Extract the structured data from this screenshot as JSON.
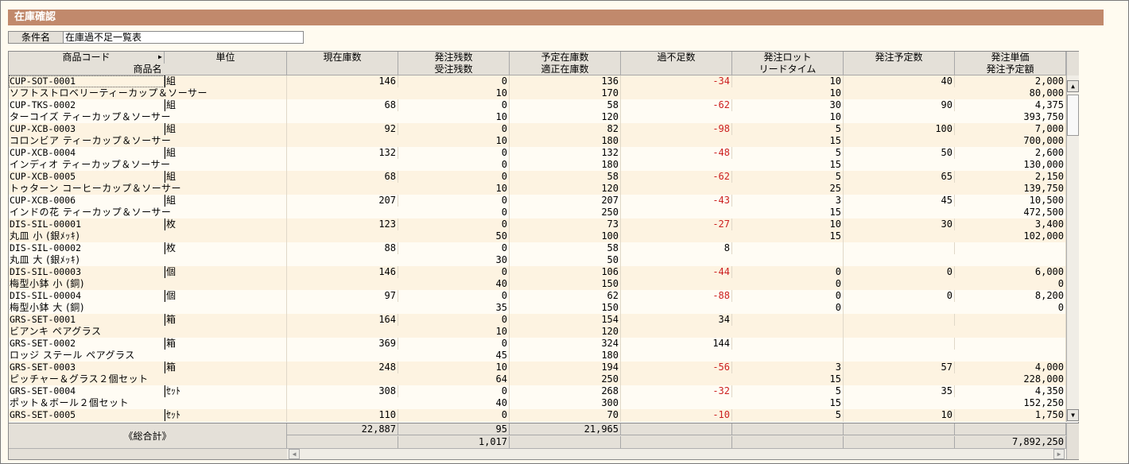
{
  "window": {
    "title": "在庫確認"
  },
  "condition": {
    "label": "条件名",
    "value": "在庫過不足一覧表"
  },
  "columns": {
    "row1": [
      "商品コード",
      "単位",
      "現在庫数",
      "発注残数",
      "予定在庫数",
      "過不足数",
      "発注ロット",
      "発注予定数",
      "発注単価"
    ],
    "row2": [
      "商品名",
      "",
      "",
      "受注残数",
      "適正在庫数",
      "",
      "リードタイム",
      "",
      "発注予定額"
    ]
  },
  "icons": {
    "sort": "sort-right-icon",
    "scroll_up": "▲",
    "scroll_down": "▼",
    "scroll_left": "◀",
    "scroll_right": "▶"
  },
  "colors": {
    "title_bg": "#c1896c",
    "negative": "#cc2020"
  },
  "rows": [
    {
      "code": "CUP-SOT-0001",
      "name": "ソフトストロベリーティーカップ＆ソーサー",
      "unit": "組",
      "stock": "146",
      "order_remain": "0",
      "recv_remain": "10",
      "planned": "136",
      "proper": "170",
      "diff": "-34",
      "neg": true,
      "lot": "10",
      "lead": "10",
      "order_qty": "40",
      "price": "2,000",
      "amount": "80,000"
    },
    {
      "code": "CUP-TKS-0002",
      "name": "ターコイズ ティーカップ＆ソーサー",
      "unit": "組",
      "stock": "68",
      "order_remain": "0",
      "recv_remain": "10",
      "planned": "58",
      "proper": "120",
      "diff": "-62",
      "neg": true,
      "lot": "30",
      "lead": "10",
      "order_qty": "90",
      "price": "4,375",
      "amount": "393,750"
    },
    {
      "code": "CUP-XCB-0003",
      "name": "コロンビア ティーカップ＆ソーサー",
      "unit": "組",
      "stock": "92",
      "order_remain": "0",
      "recv_remain": "10",
      "planned": "82",
      "proper": "180",
      "diff": "-98",
      "neg": true,
      "lot": "5",
      "lead": "15",
      "order_qty": "100",
      "price": "7,000",
      "amount": "700,000"
    },
    {
      "code": "CUP-XCB-0004",
      "name": "インディオ ティーカップ＆ソーサー",
      "unit": "組",
      "stock": "132",
      "order_remain": "0",
      "recv_remain": "0",
      "planned": "132",
      "proper": "180",
      "diff": "-48",
      "neg": true,
      "lot": "5",
      "lead": "15",
      "order_qty": "50",
      "price": "2,600",
      "amount": "130,000"
    },
    {
      "code": "CUP-XCB-0005",
      "name": "トゥターン コーヒーカップ＆ソーサー",
      "unit": "組",
      "stock": "68",
      "order_remain": "0",
      "recv_remain": "10",
      "planned": "58",
      "proper": "120",
      "diff": "-62",
      "neg": true,
      "lot": "5",
      "lead": "25",
      "order_qty": "65",
      "price": "2,150",
      "amount": "139,750"
    },
    {
      "code": "CUP-XCB-0006",
      "name": "インドの花 ティーカップ＆ソーサー",
      "unit": "組",
      "stock": "207",
      "order_remain": "0",
      "recv_remain": "0",
      "planned": "207",
      "proper": "250",
      "diff": "-43",
      "neg": true,
      "lot": "3",
      "lead": "15",
      "order_qty": "45",
      "price": "10,500",
      "amount": "472,500"
    },
    {
      "code": "DIS-SIL-00001",
      "name": "丸皿 小 (銀ﾒｯｷ)",
      "unit": "枚",
      "stock": "123",
      "order_remain": "0",
      "recv_remain": "50",
      "planned": "73",
      "proper": "100",
      "diff": "-27",
      "neg": true,
      "lot": "10",
      "lead": "15",
      "order_qty": "30",
      "price": "3,400",
      "amount": "102,000"
    },
    {
      "code": "DIS-SIL-00002",
      "name": "丸皿 大 (銀ﾒｯｷ)",
      "unit": "枚",
      "stock": "88",
      "order_remain": "0",
      "recv_remain": "30",
      "planned": "58",
      "proper": "50",
      "diff": "8",
      "neg": false,
      "lot": "",
      "lead": "",
      "order_qty": "",
      "price": "",
      "amount": ""
    },
    {
      "code": "DIS-SIL-00003",
      "name": "梅型小鉢 小 (銅)",
      "unit": "個",
      "stock": "146",
      "order_remain": "0",
      "recv_remain": "40",
      "planned": "106",
      "proper": "150",
      "diff": "-44",
      "neg": true,
      "lot": "0",
      "lead": "0",
      "order_qty": "0",
      "price": "6,000",
      "amount": "0"
    },
    {
      "code": "DIS-SIL-00004",
      "name": "梅型小鉢 大 (銅)",
      "unit": "個",
      "stock": "97",
      "order_remain": "0",
      "recv_remain": "35",
      "planned": "62",
      "proper": "150",
      "diff": "-88",
      "neg": true,
      "lot": "0",
      "lead": "0",
      "order_qty": "0",
      "price": "8,200",
      "amount": "0"
    },
    {
      "code": "GRS-SET-0001",
      "name": "ビアンキ ペアグラス",
      "unit": "箱",
      "stock": "164",
      "order_remain": "0",
      "recv_remain": "10",
      "planned": "154",
      "proper": "120",
      "diff": "34",
      "neg": false,
      "lot": "",
      "lead": "",
      "order_qty": "",
      "price": "",
      "amount": ""
    },
    {
      "code": "GRS-SET-0002",
      "name": "ロッジ ステール ペアグラス",
      "unit": "箱",
      "stock": "369",
      "order_remain": "0",
      "recv_remain": "45",
      "planned": "324",
      "proper": "180",
      "diff": "144",
      "neg": false,
      "lot": "",
      "lead": "",
      "order_qty": "",
      "price": "",
      "amount": ""
    },
    {
      "code": "GRS-SET-0003",
      "name": "ピッチャー＆グラス２個セット",
      "unit": "箱",
      "stock": "248",
      "order_remain": "10",
      "recv_remain": "64",
      "planned": "194",
      "proper": "250",
      "diff": "-56",
      "neg": true,
      "lot": "3",
      "lead": "15",
      "order_qty": "57",
      "price": "4,000",
      "amount": "228,000"
    },
    {
      "code": "GRS-SET-0004",
      "name": "ポット＆ボール２個セット",
      "unit": "ｾｯﾄ",
      "stock": "308",
      "order_remain": "0",
      "recv_remain": "40",
      "planned": "268",
      "proper": "300",
      "diff": "-32",
      "neg": true,
      "lot": "5",
      "lead": "15",
      "order_qty": "35",
      "price": "4,350",
      "amount": "152,250"
    },
    {
      "code": "GRS-SET-0005",
      "name": "",
      "unit": "ｾｯﾄ",
      "stock": "110",
      "order_remain": "0",
      "recv_remain": "",
      "planned": "70",
      "proper": "",
      "diff": "-10",
      "neg": true,
      "lot": "5",
      "lead": "",
      "order_qty": "10",
      "price": "1,750",
      "amount": ""
    }
  ],
  "totals": {
    "label": "《総合計》",
    "stock": "22,887",
    "order_remain": "95",
    "recv_remain": "1,017",
    "planned": "21,965",
    "amount": "7,892,250"
  }
}
